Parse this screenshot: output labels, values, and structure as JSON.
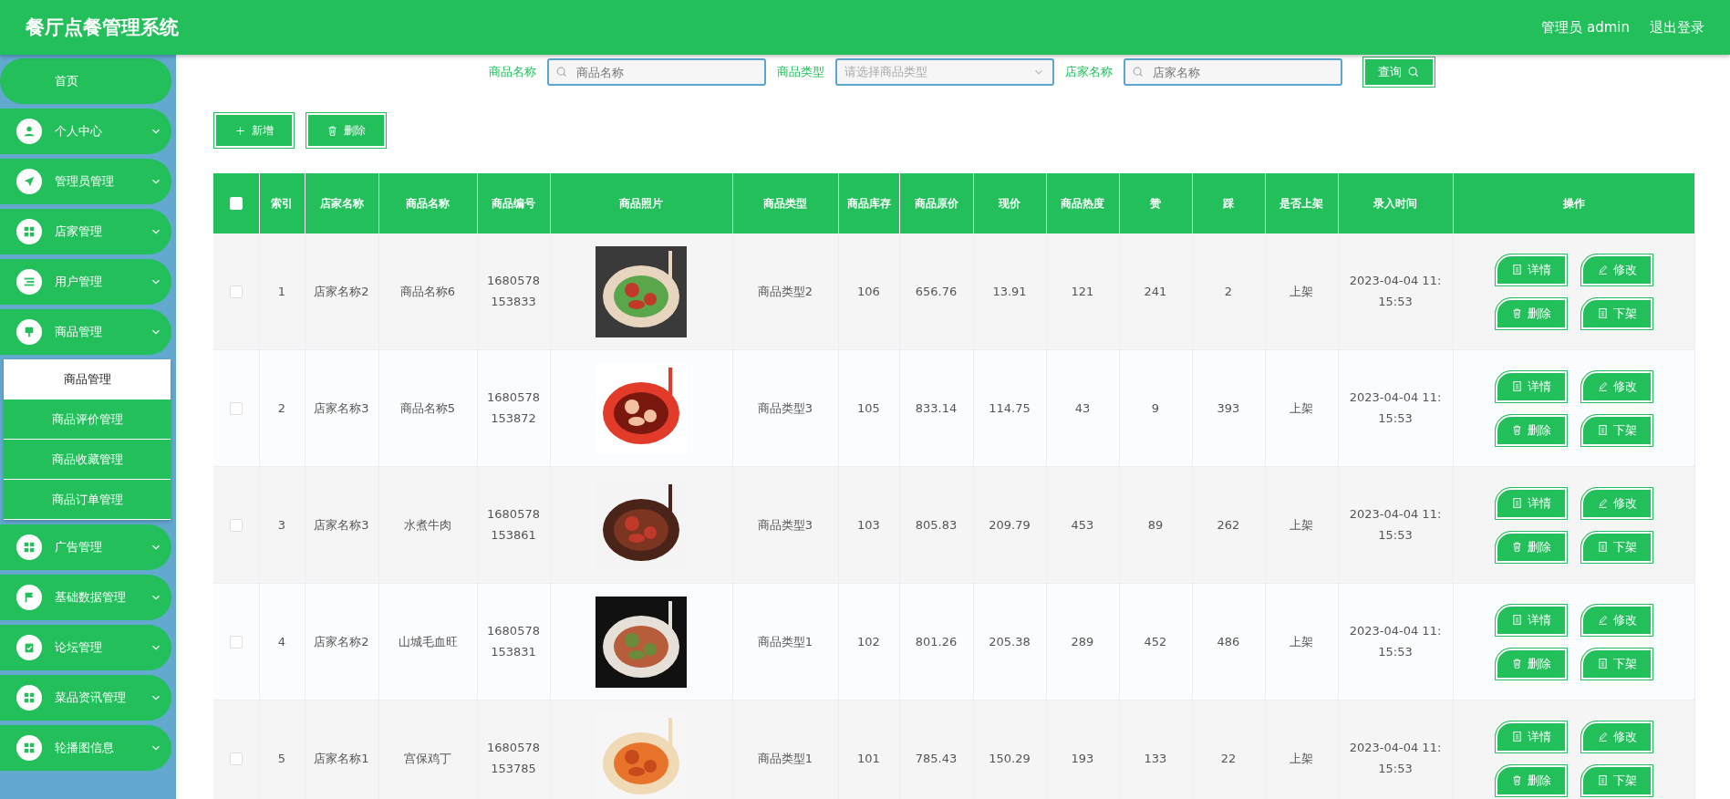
{
  "header": {
    "title": "餐厅点餐管理系统",
    "user": "管理员 admin",
    "logout": "退出登录"
  },
  "sidebar": {
    "items": [
      {
        "label": "首页"
      },
      {
        "label": "个人中心"
      },
      {
        "label": "管理员管理"
      },
      {
        "label": "店家管理"
      },
      {
        "label": "用户管理"
      },
      {
        "label": "商品管理",
        "children": [
          {
            "label": "商品管理",
            "selected": true
          },
          {
            "label": "商品评价管理",
            "selected": false
          },
          {
            "label": "商品收藏管理",
            "selected": false
          },
          {
            "label": "商品订单管理",
            "selected": false
          }
        ]
      },
      {
        "label": "广告管理"
      },
      {
        "label": "基础数据管理"
      },
      {
        "label": "论坛管理"
      },
      {
        "label": "菜品资讯管理"
      },
      {
        "label": "轮播图信息"
      }
    ]
  },
  "search": {
    "fields": [
      {
        "kind": "text",
        "label": "商品名称",
        "placeholder": "商品名称"
      },
      {
        "kind": "select",
        "label": "商品类型",
        "placeholder": "请选择商品类型"
      },
      {
        "kind": "text",
        "label": "店家名称",
        "placeholder": "店家名称"
      }
    ],
    "button": "查询"
  },
  "toolbar": [
    "新增",
    "删除"
  ],
  "table": {
    "select_all_checked": false,
    "columns": [
      "索引",
      "店家名称",
      "商品名称",
      "商品编号",
      "商品照片",
      "商品类型",
      "商品库存",
      "商品原价",
      "现价",
      "商品热度",
      "赞",
      "踩",
      "是否上架",
      "录入时间",
      "操作"
    ],
    "rows": [
      {
        "checked": false,
        "cells": [
          "1",
          "店家名称2",
          "商品名称6",
          "1680578153833",
          {
            "kind": "picture"
          },
          "商品类型2",
          "106",
          "656.76",
          "13.91",
          "121",
          "241",
          "2",
          "上架",
          "2023-04-04 11:15:53"
        ],
        "actions": [
          "详情",
          "修改",
          "删除",
          "下架"
        ]
      },
      {
        "checked": false,
        "cells": [
          "2",
          "店家名称3",
          "商品名称5",
          "1680578153872",
          {
            "kind": "picture"
          },
          "商品类型3",
          "105",
          "833.14",
          "114.75",
          "43",
          "9",
          "393",
          "上架",
          "2023-04-04 11:15:53"
        ],
        "actions": [
          "详情",
          "修改",
          "删除",
          "下架"
        ]
      },
      {
        "checked": false,
        "cells": [
          "3",
          "店家名称3",
          "水煮牛肉",
          "1680578153861",
          {
            "kind": "picture"
          },
          "商品类型3",
          "103",
          "805.83",
          "209.79",
          "453",
          "89",
          "262",
          "上架",
          "2023-04-04 11:15:53"
        ],
        "actions": [
          "详情",
          "修改",
          "删除",
          "下架"
        ]
      },
      {
        "checked": false,
        "cells": [
          "4",
          "店家名称2",
          "山城毛血旺",
          "1680578153831",
          {
            "kind": "picture"
          },
          "商品类型1",
          "102",
          "801.26",
          "205.38",
          "289",
          "452",
          "486",
          "上架",
          "2023-04-04 11:15:53"
        ],
        "actions": [
          "详情",
          "修改",
          "删除",
          "下架"
        ]
      },
      {
        "checked": false,
        "cells": [
          "5",
          "店家名称1",
          "宫保鸡丁",
          "1680578153785",
          {
            "kind": "picture"
          },
          "商品类型1",
          "101",
          "785.43",
          "150.29",
          "193",
          "133",
          "22",
          "上架",
          "2023-04-04 11:15:53"
        ],
        "actions": [
          "详情",
          "修改",
          "删除",
          "下架"
        ]
      }
    ]
  }
}
